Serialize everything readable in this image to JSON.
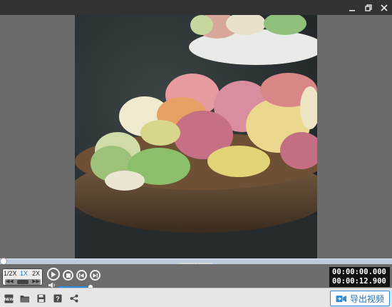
{
  "window": {
    "controls": [
      "minimize-icon",
      "restore-icon",
      "close-icon"
    ]
  },
  "video": {
    "content": "macarons-in-wooden-bowl"
  },
  "timeline": {
    "progress": 0.0
  },
  "playback": {
    "speed_options": [
      "1/2X",
      "1X",
      "2X"
    ],
    "selected_speed": "1X",
    "controls": [
      "play-icon",
      "stop-icon",
      "previous-frame-icon",
      "next-frame-icon"
    ],
    "volume_level": 0.85
  },
  "time": {
    "current": "00:00:00.000",
    "total": "00:00:12.900"
  },
  "toolbar": {
    "tools": [
      "new-project-icon",
      "open-folder-icon",
      "save-icon",
      "help-icon",
      "share-icon"
    ],
    "export_label": "导出视频"
  },
  "colors": {
    "accent": "#2b8bdd",
    "titlebar": "#323232",
    "background": "#6d6d6d"
  }
}
